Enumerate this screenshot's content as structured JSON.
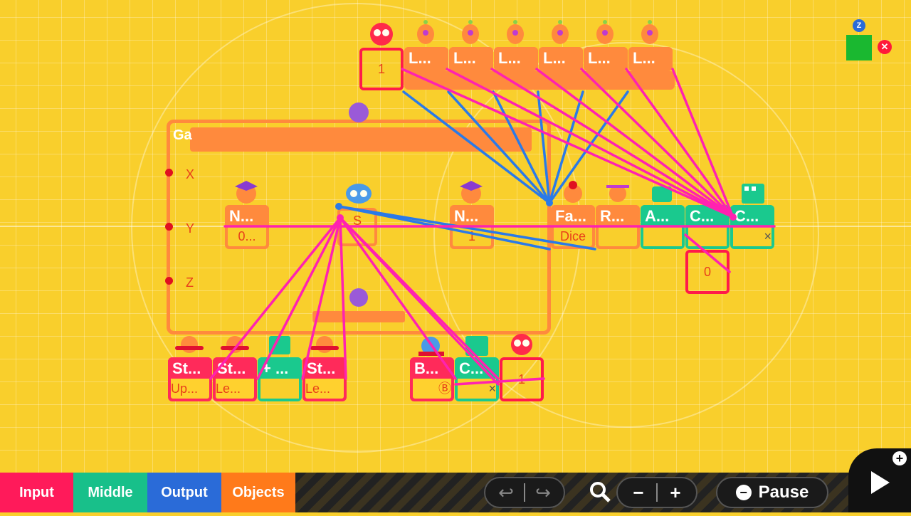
{
  "editor": {
    "game_screen_node": {
      "title": "Ga",
      "ports": [
        "X",
        "Y",
        "Z"
      ]
    },
    "top_row": [
      {
        "title": "1",
        "kind": "constant"
      },
      {
        "title": "L...",
        "kind": "object"
      },
      {
        "title": "L...",
        "kind": "object"
      },
      {
        "title": "L...",
        "kind": "object"
      },
      {
        "title": "L...",
        "kind": "object"
      },
      {
        "title": "L...",
        "kind": "object"
      },
      {
        "title": "L...",
        "kind": "object"
      }
    ],
    "middle_nodes": [
      {
        "title": "N...",
        "sub": "0..."
      },
      {
        "title": "S",
        "sub": ""
      },
      {
        "title": "N...",
        "sub": "1"
      },
      {
        "title": "Fa...",
        "sub": "Dice"
      },
      {
        "title": "R...",
        "sub": ""
      },
      {
        "title": "A...",
        "sub": ""
      },
      {
        "title": "C...",
        "sub": ""
      },
      {
        "title": "C...",
        "sub": "×"
      }
    ],
    "constant_right": {
      "value": "0"
    },
    "bottom_nodes": [
      {
        "title": "St...",
        "sub": "Up..."
      },
      {
        "title": "St...",
        "sub": "Le..."
      },
      {
        "title": "+ ...",
        "sub": ""
      },
      {
        "title": "St...",
        "sub": "Le..."
      },
      {
        "title": "B...",
        "sub": "Ⓑ"
      },
      {
        "title": "C...",
        "sub": "×"
      },
      {
        "title": "1",
        "sub": ""
      }
    ],
    "camera_badge": "Z"
  },
  "toolbar": {
    "tabs": [
      {
        "label": "Input",
        "color": "#ff1a5a"
      },
      {
        "label": "Middle",
        "color": "#18c08a"
      },
      {
        "label": "Output",
        "color": "#2a6bd8"
      },
      {
        "label": "Objects",
        "color": "#ff7a1a"
      }
    ],
    "undo_icon": "undo-arrow",
    "redo_icon": "redo-arrow",
    "zoom_icon": "magnifier",
    "zoom_out": "−",
    "zoom_in": "+",
    "pause_label": "Pause",
    "pause_icon": "minus-circle",
    "play_icon": "play-triangle",
    "add_icon": "plus-circle"
  }
}
